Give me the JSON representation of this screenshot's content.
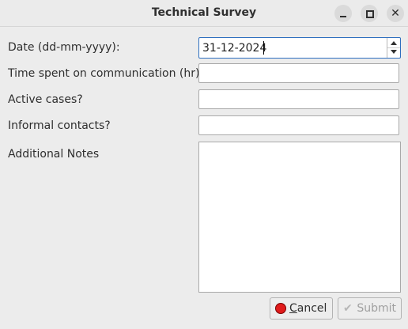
{
  "window": {
    "title": "Technical Survey",
    "controls": [
      "minimize-icon",
      "maximize-icon",
      "close-icon"
    ],
    "close_glyph": "✕"
  },
  "form": {
    "date_label": "Date (dd-mm-yyyy):",
    "date_value": "31-12-2024",
    "time_label": "Time spent on communication (hr)?",
    "time_value": "",
    "active_label": "Active cases?",
    "active_value": "",
    "informal_label": "Informal contacts?",
    "informal_value": "",
    "notes_label": "Additional Notes",
    "notes_value": ""
  },
  "buttons": {
    "cancel_label": "Cancel",
    "submit_label": "Submit",
    "submit_enabled": false
  },
  "colors": {
    "focus_border": "#2e6fbf",
    "cancel_icon": "#e01b1b"
  }
}
